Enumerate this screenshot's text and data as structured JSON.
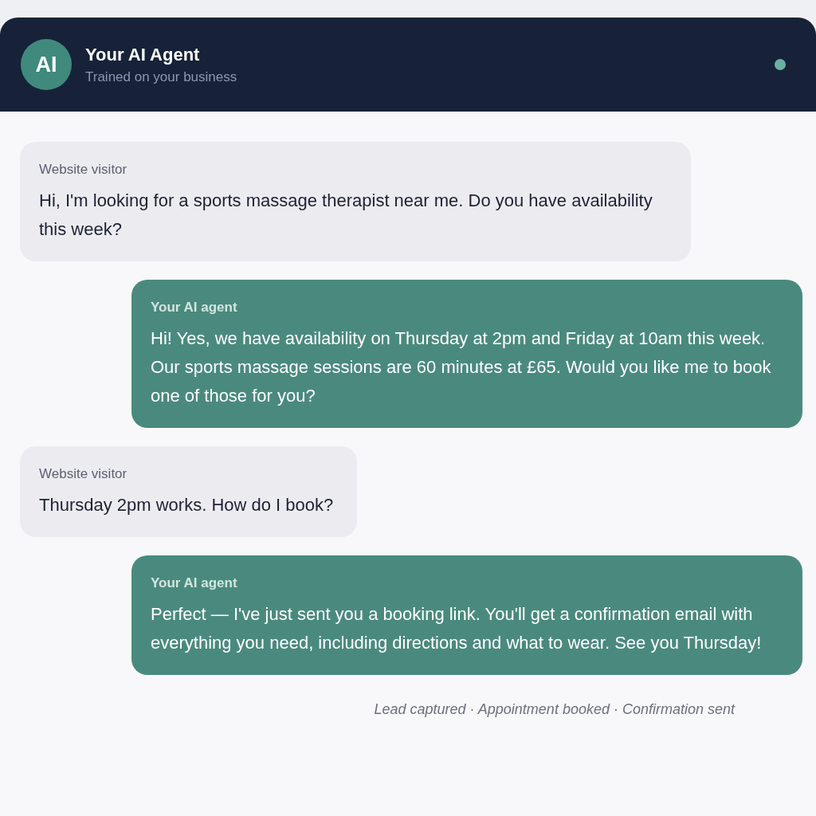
{
  "header": {
    "avatar": "AI",
    "title": "Your AI Agent",
    "subtitle": "Trained on your business",
    "online": true
  },
  "messages": [
    {
      "kind": "visitor",
      "label": "Website visitor",
      "text": "Hi, I'm looking for a sports massage therapist near me. Do you have availability this week?"
    },
    {
      "kind": "agent",
      "label": "Your AI agent",
      "text": "Hi! Yes, we have availability on Thursday at 2pm and Friday at 10am this week. Our sports massage sessions are 60 minutes at £65. Would you like me to book one of those for you?"
    },
    {
      "kind": "visitor",
      "label": "Website visitor",
      "text": "Thursday 2pm works. How do I book?"
    },
    {
      "kind": "agent",
      "label": "Your AI agent",
      "text": "Perfect — I've just sent you a booking link. You'll get a confirmation email with everything you need, including directions and what to wear. See you Thursday!"
    }
  ],
  "status_note": "Lead captured · Appointment booked · Confirmation sent"
}
